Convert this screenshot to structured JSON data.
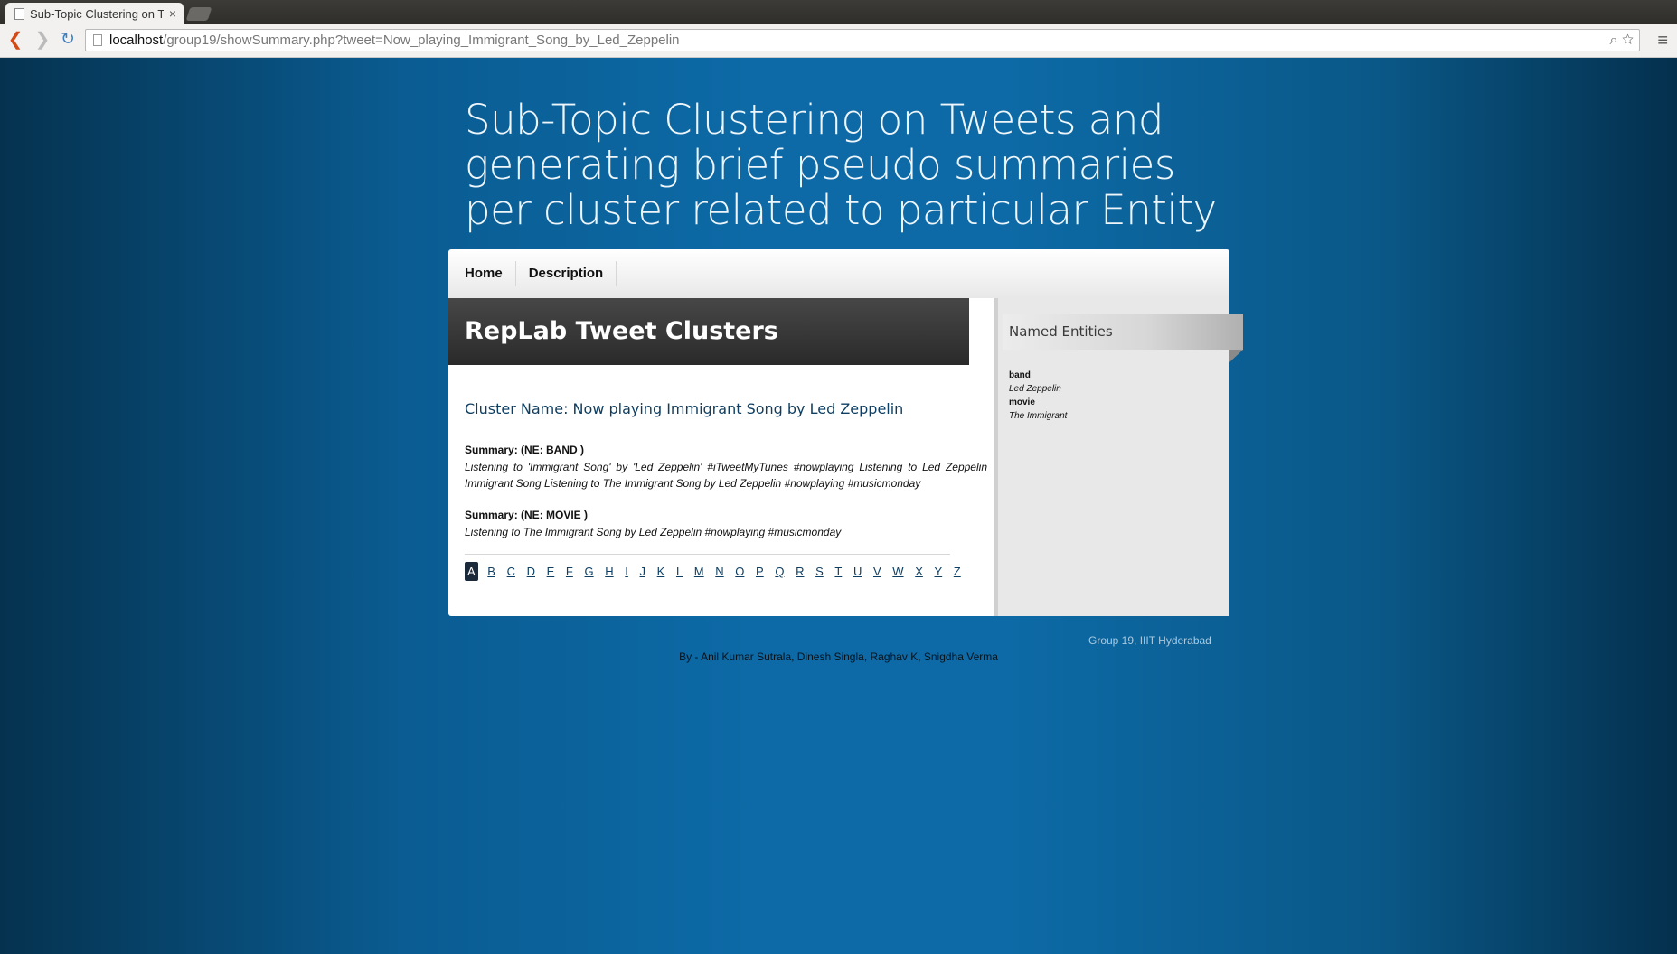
{
  "browser": {
    "tab_title": "Sub-Topic Clustering on T",
    "tab_close": "×",
    "url_host": "localhost",
    "url_path": "/group19/showSummary.php?tweet=Now_playing_Immigrant_Song_by_Led_Zeppelin"
  },
  "site": {
    "title": "Sub-Topic Clustering on Tweets and generating brief pseudo summaries per cluster related to particular Entity"
  },
  "nav": {
    "home": "Home",
    "description": "Description"
  },
  "main": {
    "header": "RepLab Tweet Clusters",
    "cluster_name": "Cluster Name: Now playing Immigrant Song by Led Zeppelin",
    "summaries": [
      {
        "title": "Summary: (NE: BAND )",
        "text": "Listening to 'Immigrant Song' by 'Led Zeppelin' #iTweetMyTunes #nowplaying Listening to Led Zeppelin Immigrant Song Listening to The Immigrant Song by Led Zeppelin #nowplaying #musicmonday"
      },
      {
        "title": "Summary: (NE: MOVIE )",
        "text": "Listening to The Immigrant Song by Led Zeppelin #nowplaying #musicmonday"
      }
    ],
    "alphabet": [
      "A",
      "B",
      "C",
      "D",
      "E",
      "F",
      "G",
      "H",
      "I",
      "J",
      "K",
      "L",
      "M",
      "N",
      "O",
      "P",
      "Q",
      "R",
      "S",
      "T",
      "U",
      "V",
      "W",
      "X",
      "Y",
      "Z"
    ],
    "alphabet_active": "A"
  },
  "sidebar": {
    "title": "Named Entities",
    "entities": [
      {
        "type": "band",
        "value": "Led Zeppelin"
      },
      {
        "type": "movie",
        "value": "The Immigrant"
      }
    ]
  },
  "footer": {
    "group": "Group 19, IIIT Hyderabad",
    "credit": "By - Anil Kumar Sutrala, Dinesh Singla, Raghav K, Snigdha Verma"
  }
}
